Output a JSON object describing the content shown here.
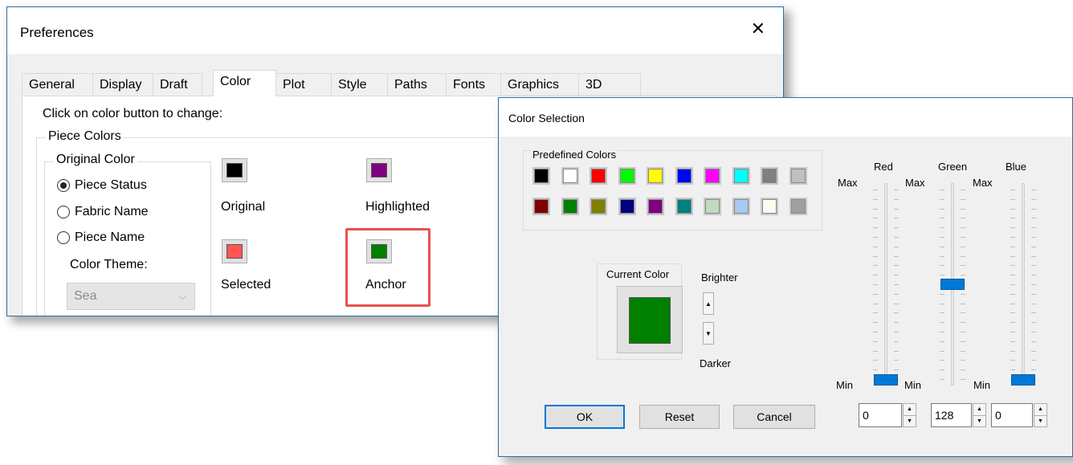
{
  "preferences": {
    "title": "Preferences",
    "close_glyph": "✕",
    "tabs": [
      {
        "label": "General"
      },
      {
        "label": "Display"
      },
      {
        "label": "Draft"
      },
      {
        "label": "Color"
      },
      {
        "label": "Plot"
      },
      {
        "label": "Style"
      },
      {
        "label": "Paths"
      },
      {
        "label": "Fonts"
      },
      {
        "label": "Graphics"
      },
      {
        "label": "3D"
      }
    ],
    "active_tab": "Color",
    "instruction": "Click on color button to change:",
    "piece_colors_label": "Piece Colors",
    "original_color_label": "Original Color",
    "radios": [
      {
        "label": "Piece Status",
        "checked": true
      },
      {
        "label": "Fabric Name",
        "checked": false
      },
      {
        "label": "Piece Name",
        "checked": false
      }
    ],
    "color_theme_label": "Color Theme:",
    "color_theme_value": "Sea",
    "swatches": [
      {
        "label": "Original",
        "color": "#000000"
      },
      {
        "label": "Highlighted",
        "color": "#800080"
      },
      {
        "label": "Selected",
        "color": "#ff5555"
      },
      {
        "label": "Anchor",
        "color": "#008000"
      }
    ]
  },
  "color_selection": {
    "title": "Color Selection",
    "predefined_label": "Predefined Colors",
    "predefined_row1": [
      "#000000",
      "#ffffff",
      "#ff0000",
      "#00ff00",
      "#ffff00",
      "#0000ff",
      "#ff00ff",
      "#00ffff",
      "#808080",
      "#c0c0c0"
    ],
    "predefined_row2": [
      "#800000",
      "#008000",
      "#808000",
      "#000080",
      "#800080",
      "#008080",
      "#c0dcc0",
      "#a6caf0",
      "#fffbf0",
      "#a0a0a4"
    ],
    "current_color_label": "Current Color",
    "current_color": "#008000",
    "brighter_label": "Brighter",
    "darker_label": "Darker",
    "channels": [
      {
        "name": "Red",
        "max_label": "Max",
        "min_label": "Min",
        "value": "0",
        "level": 0
      },
      {
        "name": "Green",
        "max_label": "Max",
        "min_label": "Min",
        "value": "128",
        "level": 0.5
      },
      {
        "name": "Blue",
        "max_label": "Max",
        "min_label": "Min",
        "value": "0",
        "level": 0
      }
    ],
    "ok_label": "OK",
    "reset_label": "Reset",
    "cancel_label": "Cancel"
  }
}
